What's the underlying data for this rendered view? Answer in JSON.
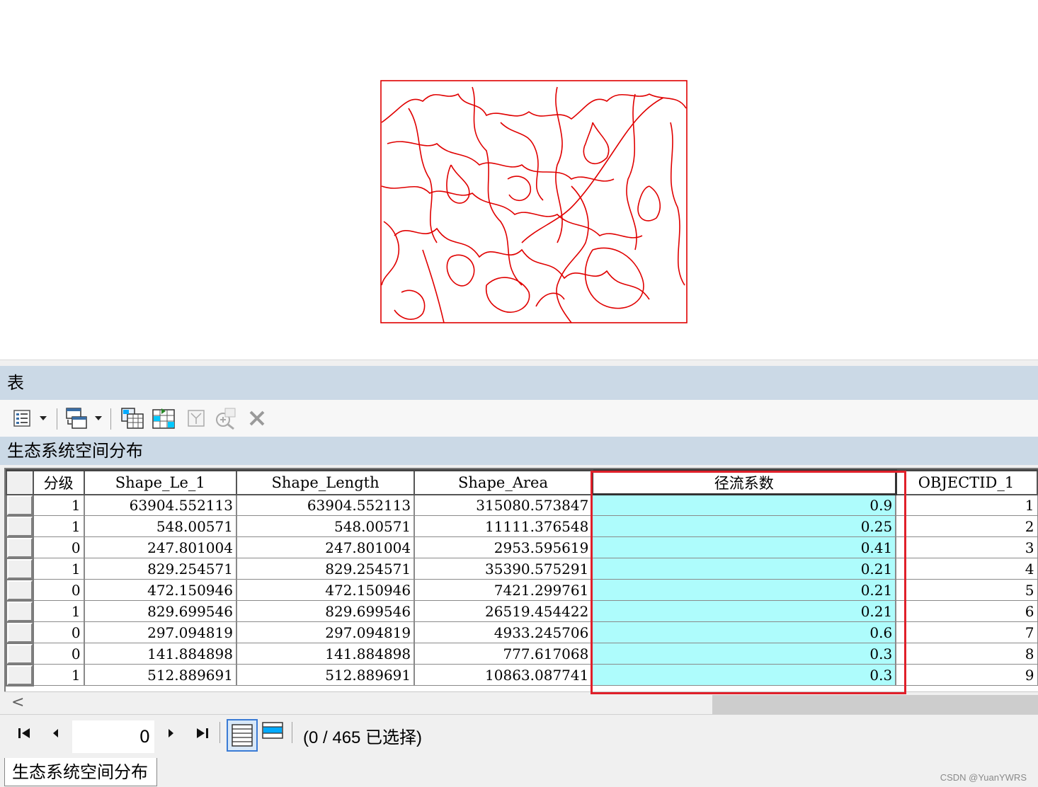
{
  "map": {
    "stroke_color": "#e00000"
  },
  "table_window": {
    "title": "表",
    "layer_name": "生态系统空间分布",
    "toolbar": {
      "icons": [
        "table-options-icon",
        "dropdown-icon",
        "related-tables-icon",
        "dropdown-icon",
        "select-by-attributes-icon",
        "switch-selection-icon",
        "clear-selection-icon",
        "zoom-to-selected-icon",
        "delete-selected-icon"
      ]
    }
  },
  "grid": {
    "columns": [
      "分级",
      "Shape_Le_1",
      "Shape_Length",
      "Shape_Area",
      "径流系数",
      "OBJECTID_1"
    ],
    "selected_column": "径流系数",
    "rows": [
      {
        "fenji": "1",
        "shape_le_1": "63904.552113",
        "shape_length": "63904.552113",
        "shape_area": "315080.573847",
        "coef": "0.9",
        "objectid": "1"
      },
      {
        "fenji": "1",
        "shape_le_1": "548.00571",
        "shape_length": "548.00571",
        "shape_area": "11111.376548",
        "coef": "0.25",
        "objectid": "2"
      },
      {
        "fenji": "0",
        "shape_le_1": "247.801004",
        "shape_length": "247.801004",
        "shape_area": "2953.595619",
        "coef": "0.41",
        "objectid": "3"
      },
      {
        "fenji": "1",
        "shape_le_1": "829.254571",
        "shape_length": "829.254571",
        "shape_area": "35390.575291",
        "coef": "0.21",
        "objectid": "4"
      },
      {
        "fenji": "0",
        "shape_le_1": "472.150946",
        "shape_length": "472.150946",
        "shape_area": "7421.299761",
        "coef": "0.21",
        "objectid": "5"
      },
      {
        "fenji": "1",
        "shape_le_1": "829.699546",
        "shape_length": "829.699546",
        "shape_area": "26519.454422",
        "coef": "0.21",
        "objectid": "6"
      },
      {
        "fenji": "0",
        "shape_le_1": "297.094819",
        "shape_length": "297.094819",
        "shape_area": "4933.245706",
        "coef": "0.6",
        "objectid": "7"
      },
      {
        "fenji": "0",
        "shape_le_1": "141.884898",
        "shape_length": "141.884898",
        "shape_area": "777.617068",
        "coef": "0.3",
        "objectid": "8"
      },
      {
        "fenji": "1",
        "shape_le_1": "512.889691",
        "shape_length": "512.889691",
        "shape_area": "10863.087741",
        "coef": "0.3",
        "objectid": "9"
      }
    ],
    "selected_cell_color": "#aefcfc",
    "highlight_color": "#e0202a"
  },
  "navbar": {
    "current_record": "0",
    "status": "(0 / 465 已选择)"
  },
  "bottom_tab": {
    "label": "生态系统空间分布"
  },
  "watermark": "CSDN @YuanYWRS"
}
